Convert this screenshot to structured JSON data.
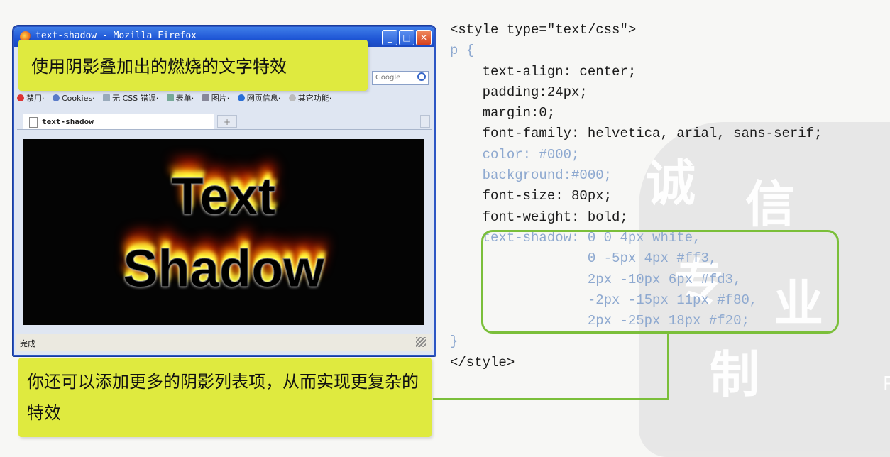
{
  "browser": {
    "window_title": "text-shadow - Mozilla Firefox",
    "search_placeholder": "Google",
    "toolbar_items": [
      "禁用·",
      "Cookies·",
      "无 CSS",
      "错误·",
      "表单·",
      "图片·",
      "网页信息·",
      "其它功能·"
    ],
    "tab_label": "text-shadow",
    "new_tab": "+",
    "page_line1": "Text",
    "page_line2": "Shadow",
    "status_text": "完成"
  },
  "callouts": {
    "top": "使用阴影叠加出的燃烧的文字特效",
    "bottom": "你还可以添加更多的阴影列表项，从而实现更复杂的特效"
  },
  "code_lines": [
    {
      "text": "<style type=\"text/css\">",
      "dim": false
    },
    {
      "text": "p {",
      "dim": true
    },
    {
      "text": "    text-align: center;",
      "dim": false
    },
    {
      "text": "    padding:24px;",
      "dim": false
    },
    {
      "text": "    margin:0;",
      "dim": false
    },
    {
      "text": "    font-family: helvetica, arial, sans-serif;",
      "dim": false
    },
    {
      "text": "    color: #000;",
      "dim": true
    },
    {
      "text": "    background:#000;",
      "dim": true
    },
    {
      "text": "    font-size: 80px;",
      "dim": false
    },
    {
      "text": "    font-weight: bold;",
      "dim": false
    },
    {
      "text": "    text-shadow: 0 0 4px white,",
      "dim": true
    },
    {
      "text": "                 0 -5px 4px #ff3,",
      "dim": true
    },
    {
      "text": "                 2px -10px 6px #fd3,",
      "dim": true
    },
    {
      "text": "                 -2px -15px 11px #f80,",
      "dim": true
    },
    {
      "text": "                 2px -25px 18px #f20;",
      "dim": true
    },
    {
      "text": "}",
      "dim": true
    },
    {
      "text": "</style>",
      "dim": false
    }
  ],
  "colors": {
    "callout_bg": "#dfea3f",
    "highlight_border": "#7bbf3a",
    "dim_code": "#8ea9d0"
  }
}
